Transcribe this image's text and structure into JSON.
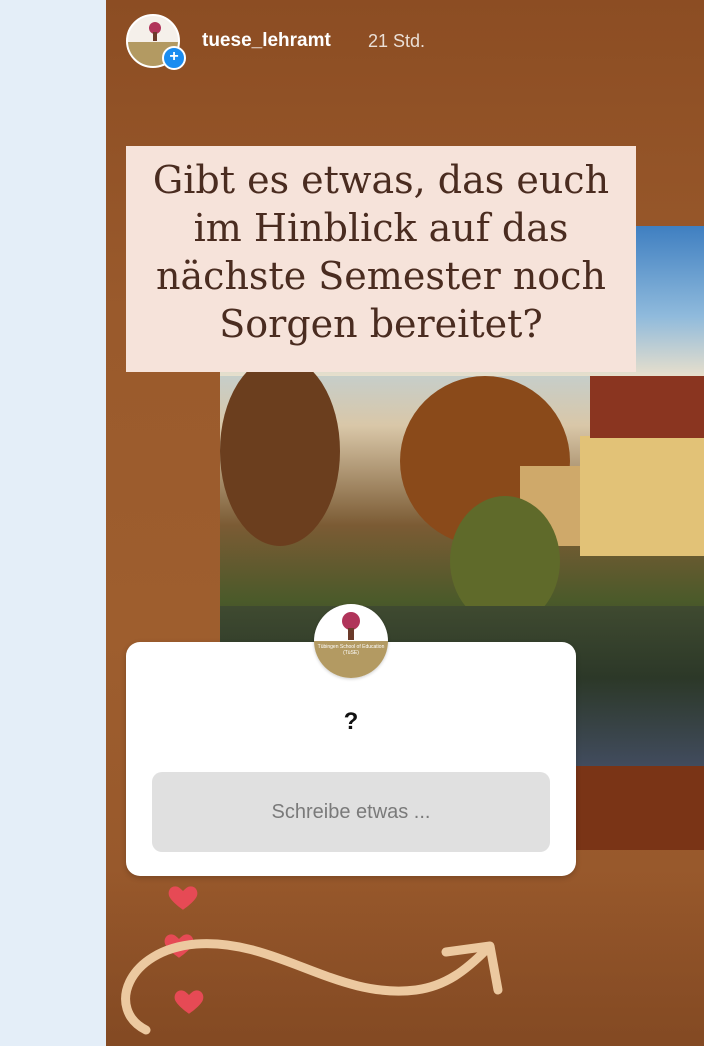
{
  "story": {
    "username": "tuese_lehramt",
    "timestamp": "21 Std.",
    "add_icon": "plus-icon",
    "question": "Gibt es etwas, das euch im Hinblick auf das nächste Semester noch Sorgen bereitet?",
    "card": {
      "avatar_label": "Tübingen School of Education (TüSE)",
      "question_mark": "?",
      "input_placeholder": "Schreibe etwas ..."
    },
    "stickers": [
      "heart-icon",
      "heart-icon",
      "heart-icon",
      "curved-arrow-icon"
    ]
  },
  "colors": {
    "story_background": "#9a5a2c",
    "banner_background": "#f6e3da",
    "banner_text": "#4a2c20",
    "heart": "#e64a55",
    "arrow": "#ecc9a0",
    "plus_badge": "#1a8cf0"
  }
}
